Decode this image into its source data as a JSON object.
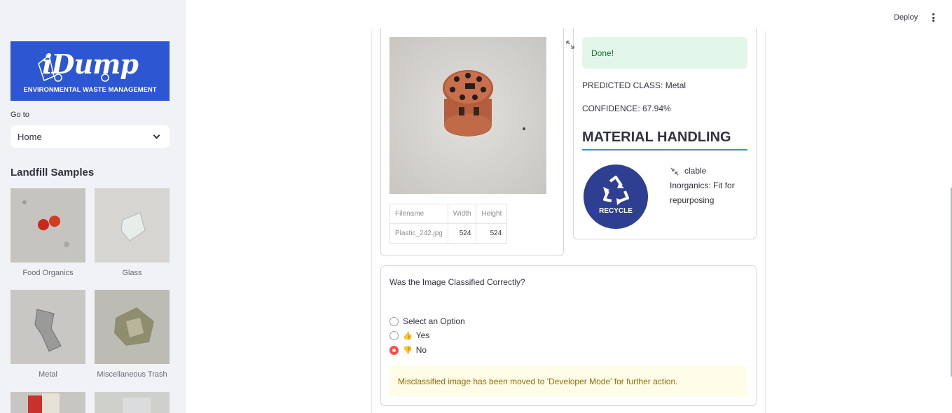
{
  "sidebar": {
    "logo": {
      "brand": "iDump",
      "tagline": "ENVIRONMENTAL WASTE MANAGEMENT"
    },
    "goto_label": "Go to",
    "select_value": "Home",
    "samples_title": "Landfill Samples",
    "samples": [
      {
        "label": "Food Organics"
      },
      {
        "label": "Glass"
      },
      {
        "label": "Metal"
      },
      {
        "label": "Miscellaneous Trash"
      }
    ]
  },
  "topbar": {
    "deploy_label": "Deploy"
  },
  "result": {
    "table_headers": [
      "Filename",
      "Width",
      "Height"
    ],
    "table_row": [
      "Plastic_242.jpg",
      "524",
      "524"
    ],
    "status": "Done!",
    "predicted": "PREDICTED CLASS: Metal",
    "confidence": "CONFIDENCE: 67.94%",
    "handling_title": "MATERIAL HANDLING",
    "recycle_text": "RECYCLE",
    "handling_text_1": "clable",
    "handling_text_2": "Inorganics: Fit for repurposing"
  },
  "feedback": {
    "question": "Was the Image Classified Correctly?",
    "options": [
      {
        "label": "Select an Option",
        "emoji": "",
        "selected": false
      },
      {
        "label": "Yes",
        "emoji": "👍",
        "selected": false
      },
      {
        "label": "No",
        "emoji": "👎",
        "selected": true
      }
    ],
    "warning": "Misclassified image has been moved to 'Developer Mode' for further action."
  },
  "colors": {
    "accent": "#ff4b4b",
    "logo_bg": "#2d56d2",
    "recycle_bg": "#2e3f91",
    "success_bg": "#e2f7ea",
    "warning_bg": "#fffce7"
  }
}
